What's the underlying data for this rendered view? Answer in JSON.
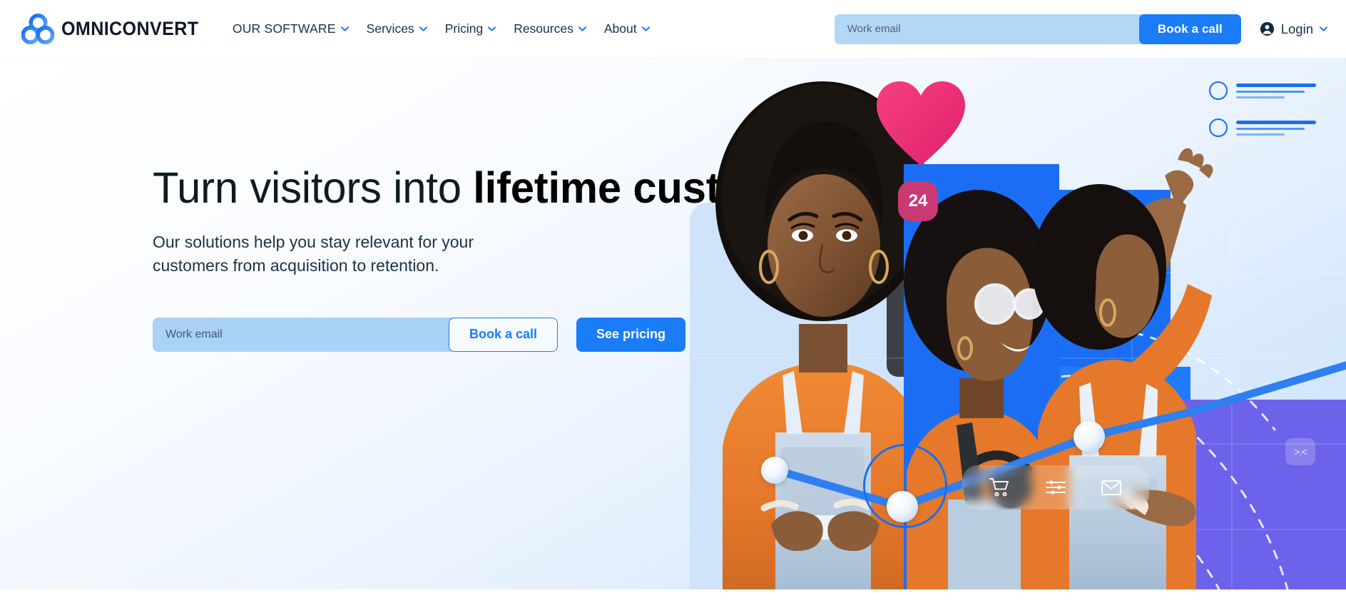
{
  "brand": {
    "name": "OMNICONVERT",
    "logo_icon": "three-circles-logo",
    "accent": "#1a7cf7"
  },
  "header": {
    "nav": [
      {
        "label": "OUR SOFTWARE",
        "caret": "chevron-down-icon"
      },
      {
        "label": "Services",
        "caret": "chevron-down-icon"
      },
      {
        "label": "Pricing",
        "caret": "chevron-down-icon"
      },
      {
        "label": "Resources",
        "caret": "chevron-down-icon"
      },
      {
        "label": "About",
        "caret": "chevron-down-icon"
      }
    ],
    "email_placeholder": "Work email",
    "email_value": "",
    "book_call_label": "Book a call",
    "login_label": "Login",
    "login_icon": "user-circle-icon",
    "login_caret": "chevron-down-icon"
  },
  "hero": {
    "headline_light": "Turn visitors into ",
    "headline_bold": "lifetime customers",
    "subhead": "Our solutions help you stay relevant for your customers from acquisition to retention.",
    "email_placeholder": "Work email",
    "email_value": "",
    "book_call_label": "Book a call",
    "see_pricing_label": "See pricing"
  },
  "art": {
    "heart_icon": "heart-icon",
    "heart_color": "#ed3a7e",
    "badge_count": "24",
    "badge_color": "#c93a74",
    "checklist_items": 2,
    "pill_icons": [
      "shopping-cart-icon",
      "sliders-icon",
      "envelope-icon"
    ],
    "kawaii_face": ">.<",
    "panel_blue": "#1b6ef3",
    "panel_purple": "#6c63ea",
    "panel_lightblue": "#cfe3fa",
    "chart_line_color": "#2f7ff0"
  }
}
